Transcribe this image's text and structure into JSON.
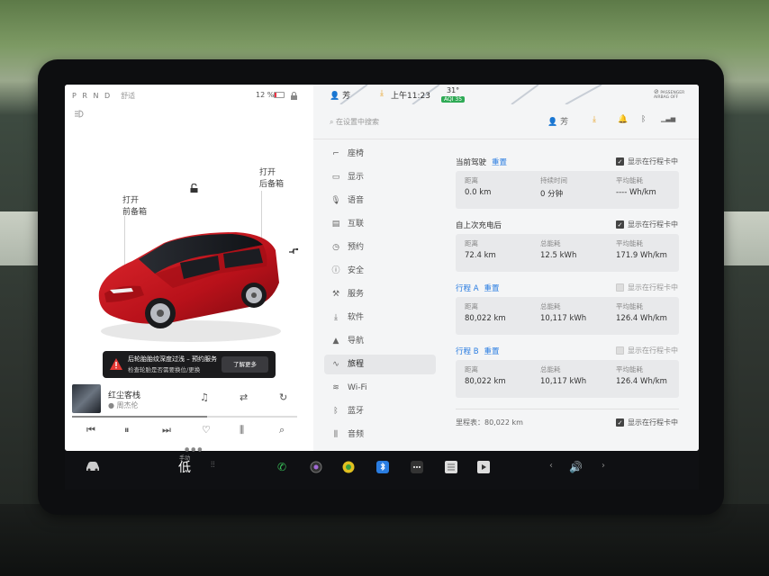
{
  "status": {
    "gears": "P R N D",
    "mode": "舒适",
    "battery": "12 %",
    "profile": "芳",
    "time": "上午11:23",
    "temperature": "31°",
    "aqi": "AQI 35",
    "airbag_text": "PASSENGER AIRBAG OFF"
  },
  "car": {
    "frunk_label": "打开\n前备箱",
    "trunk_label": "打开\n后备箱",
    "notice_title": "后轮胎胎纹深度过浅 – 预约服务",
    "notice_sub": "检查轮胎是否需要换位/更换",
    "notice_button": "了解更多"
  },
  "music": {
    "song": "红尘客栈",
    "artist": "周杰伦",
    "progress": 0.6
  },
  "search": {
    "placeholder": "在设置中搜索"
  },
  "nav": {
    "items": [
      {
        "label": "座椅",
        "icon": "seat-icon"
      },
      {
        "label": "显示",
        "icon": "display-icon"
      },
      {
        "label": "语音",
        "icon": "microphone-icon"
      },
      {
        "label": "互联",
        "icon": "connectivity-icon"
      },
      {
        "label": "预约",
        "icon": "clock-icon"
      },
      {
        "label": "安全",
        "icon": "safety-icon"
      },
      {
        "label": "服务",
        "icon": "wrench-icon"
      },
      {
        "label": "软件",
        "icon": "download-icon"
      },
      {
        "label": "导航",
        "icon": "navigation-icon"
      },
      {
        "label": "旅程",
        "icon": "trip-icon"
      },
      {
        "label": "Wi-Fi",
        "icon": "wifi-icon"
      },
      {
        "label": "蓝牙",
        "icon": "bluetooth-icon"
      },
      {
        "label": "音频",
        "icon": "audio-icon"
      }
    ],
    "active": "旅程"
  },
  "trips": {
    "current": {
      "title": "当前驾驶",
      "reset": "重置",
      "show_label": "显示在行程卡中",
      "show_checked": true,
      "cells": [
        {
          "k": "距离",
          "v": "0.0 km"
        },
        {
          "k": "持续时间",
          "v": "0 分钟"
        },
        {
          "k": "平均能耗",
          "v": "---- Wh/km"
        }
      ]
    },
    "since_charge": {
      "title": "自上次充电后",
      "show_label": "显示在行程卡中",
      "show_checked": true,
      "cells": [
        {
          "k": "距离",
          "v": "72.4 km"
        },
        {
          "k": "总能耗",
          "v": "12.5 kWh"
        },
        {
          "k": "平均能耗",
          "v": "171.9 Wh/km"
        }
      ]
    },
    "trip_a": {
      "title": "行程 A",
      "reset": "重置",
      "show_label": "显示在行程卡中",
      "show_checked": false,
      "cells": [
        {
          "k": "距离",
          "v": "80,022 km"
        },
        {
          "k": "总能耗",
          "v": "10,117 kWh"
        },
        {
          "k": "平均能耗",
          "v": "126.4 Wh/km"
        }
      ]
    },
    "trip_b": {
      "title": "行程 B",
      "reset": "重置",
      "show_label": "显示在行程卡中",
      "show_checked": false,
      "cells": [
        {
          "k": "距离",
          "v": "80,022 km"
        },
        {
          "k": "总能耗",
          "v": "10,117 kWh"
        },
        {
          "k": "平均能耗",
          "v": "126.4 Wh/km"
        }
      ]
    },
    "odometer": "里程表：80,022 km",
    "odometer_show_label": "显示在行程卡中",
    "odometer_show_checked": true
  },
  "dock": {
    "temp_top": "手动",
    "temp_value": "低",
    "volume_icon": "volume-icon"
  },
  "colors": {
    "accent": "#2a7de1",
    "car_red": "#c8141c",
    "aqi_green": "#2eaa55",
    "download_orange": "#e8a020"
  }
}
